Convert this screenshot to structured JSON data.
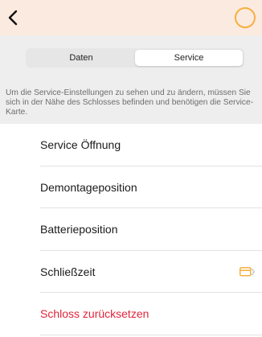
{
  "navbar": {
    "back_icon": "chevron-left-icon",
    "status_icon": "ring-icon",
    "status_color": "#f5b041",
    "background": "#fbeadf"
  },
  "tabs": [
    {
      "label": "Daten",
      "active": false
    },
    {
      "label": "Service",
      "active": true
    }
  ],
  "info": {
    "text": "Um die Service-Einstellungen zu sehen und zu ändern, müssen Sie sich in der Nähe des Schlosses befinden und benötigen die Service-Karte."
  },
  "menu": [
    {
      "label": "Service Öffnung"
    },
    {
      "label": "Demontageposition"
    },
    {
      "label": "Batterieposition"
    },
    {
      "label": "Schließzeit",
      "accessory_icon": "card-chevron-icon",
      "accent": "#f5b041"
    },
    {
      "label": "Schloss zurücksetzen",
      "destructive": true,
      "color": "#e0243a"
    }
  ]
}
